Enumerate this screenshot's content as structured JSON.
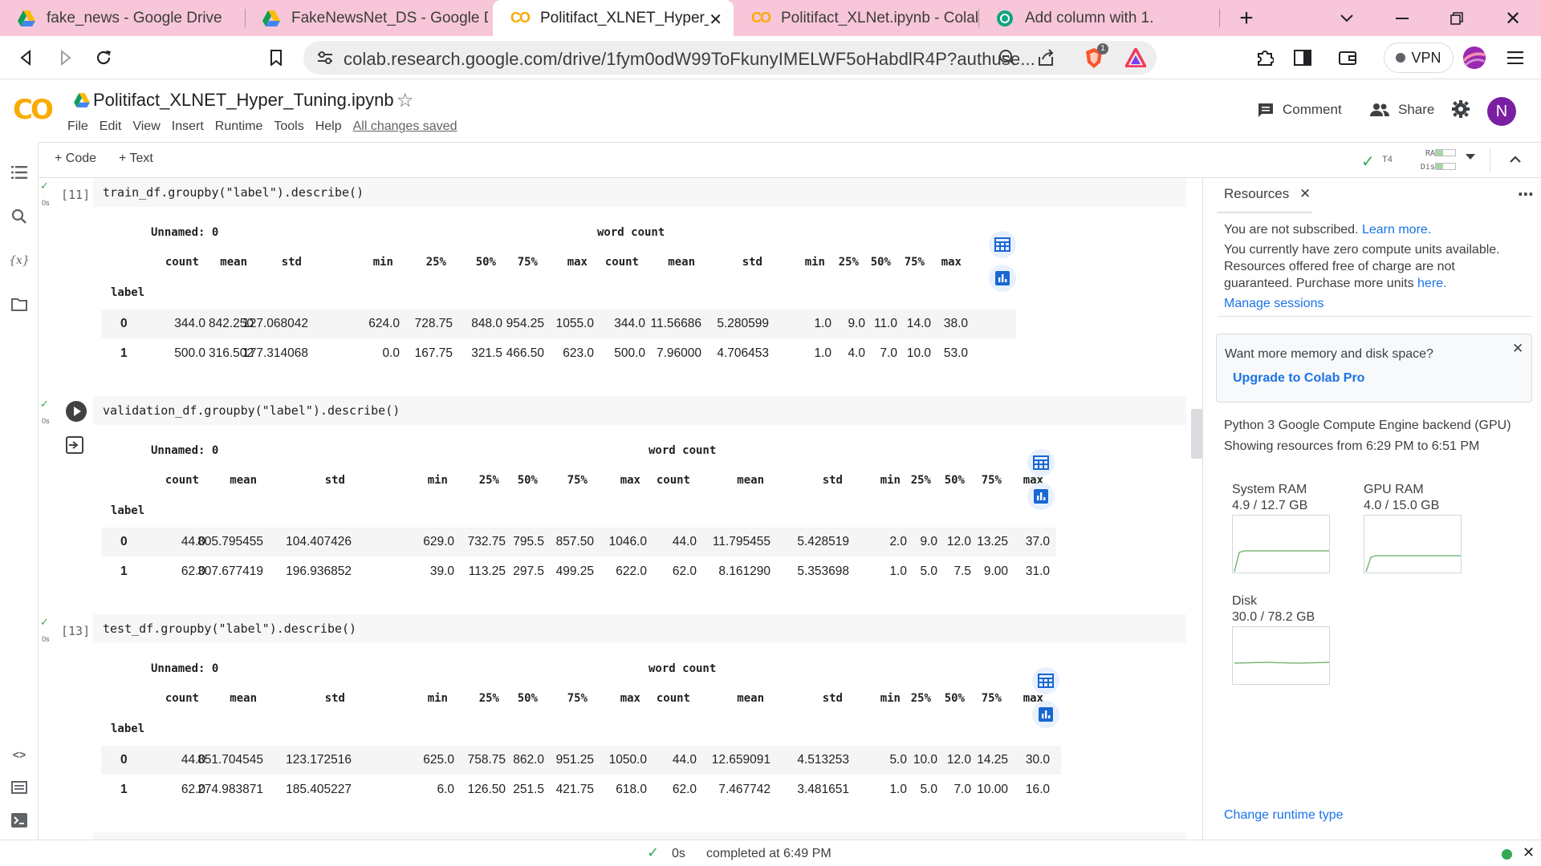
{
  "tabs": [
    {
      "title": "fake_news - Google Drive",
      "icon": "google-drive-icon"
    },
    {
      "title": "FakeNewsNet_DS - Google Drive",
      "icon": "google-drive-icon"
    },
    {
      "title": "Politifact_XLNET_Hyper_Tuning.ipynb",
      "icon": "colab-icon",
      "active": true
    },
    {
      "title": "Politifact_XLNet.ipynb - Colaboratory",
      "icon": "colab-icon"
    },
    {
      "title": "Add column with 1.",
      "icon": "chatgpt-icon"
    }
  ],
  "address": {
    "url": "colab.research.google.com/drive/1fym0odW99ToFkunyIMELWF5oHabdlR4P?authuse...",
    "shields_count": "1",
    "vpn_label": "VPN"
  },
  "colab": {
    "logo": "CO",
    "notebook_title": "Politifact_XLNET_Hyper_Tuning.ipynb",
    "menu": [
      "File",
      "Edit",
      "View",
      "Insert",
      "Runtime",
      "Tools",
      "Help"
    ],
    "saved_status": "All changes saved",
    "comment_label": "Comment",
    "share_label": "Share",
    "avatar_letter": "N"
  },
  "toolbar": {
    "code_label": "+ Code",
    "text_label": "+ Text",
    "runtime": "T4",
    "ram_label": "RAM",
    "disk_label": "Disk",
    "ram_fraction": 0.39,
    "disk_fraction": 0.38
  },
  "cells": [
    {
      "exec_label": "[11]",
      "time": "0s",
      "code": "train_df.groupby(\"label\").describe()",
      "group1": "Unnamed: 0",
      "group2": "word count",
      "columns": [
        "count",
        "mean",
        "std",
        "min",
        "25%",
        "50%",
        "75%",
        "max",
        "count",
        "mean",
        "std",
        "min",
        "25%",
        "50%",
        "75%",
        "max"
      ],
      "index_name": "label",
      "rows": [
        {
          "label": "0",
          "values": [
            "344.0",
            "842.250",
            "127.068042",
            "624.0",
            "728.75",
            "848.0",
            "954.25",
            "1055.0",
            "344.0",
            "11.56686",
            "5.280599",
            "1.0",
            "9.0",
            "11.0",
            "14.0",
            "38.0"
          ]
        },
        {
          "label": "1",
          "values": [
            "500.0",
            "316.502",
            "177.314068",
            "0.0",
            "167.75",
            "321.5",
            "466.50",
            "623.0",
            "500.0",
            "7.96000",
            "4.706453",
            "1.0",
            "4.0",
            "7.0",
            "10.0",
            "53.0"
          ]
        }
      ]
    },
    {
      "exec_label": "",
      "time": "0s",
      "code": "validation_df.groupby(\"label\").describe()",
      "group1": "Unnamed: 0",
      "group2": "word count",
      "columns": [
        "count",
        "mean",
        "std",
        "min",
        "25%",
        "50%",
        "75%",
        "max",
        "count",
        "mean",
        "std",
        "min",
        "25%",
        "50%",
        "75%",
        "max"
      ],
      "index_name": "label",
      "rows": [
        {
          "label": "0",
          "values": [
            "44.0",
            "805.795455",
            "104.407426",
            "629.0",
            "732.75",
            "795.5",
            "857.50",
            "1046.0",
            "44.0",
            "11.795455",
            "5.428519",
            "2.0",
            "9.0",
            "12.0",
            "13.25",
            "37.0"
          ]
        },
        {
          "label": "1",
          "values": [
            "62.0",
            "307.677419",
            "196.936852",
            "39.0",
            "113.25",
            "297.5",
            "499.25",
            "622.0",
            "62.0",
            "8.161290",
            "5.353698",
            "1.0",
            "5.0",
            "7.5",
            "9.00",
            "31.0"
          ]
        }
      ]
    },
    {
      "exec_label": "[13]",
      "time": "0s",
      "code": "test_df.groupby(\"label\").describe()",
      "group1": "Unnamed: 0",
      "group2": "word count",
      "columns": [
        "count",
        "mean",
        "std",
        "min",
        "25%",
        "50%",
        "75%",
        "max",
        "count",
        "mean",
        "std",
        "min",
        "25%",
        "50%",
        "75%",
        "max"
      ],
      "index_name": "label",
      "rows": [
        {
          "label": "0",
          "values": [
            "44.0",
            "851.704545",
            "123.172516",
            "625.0",
            "758.75",
            "862.0",
            "951.25",
            "1050.0",
            "44.0",
            "12.659091",
            "4.513253",
            "5.0",
            "10.0",
            "12.0",
            "14.25",
            "30.0"
          ]
        },
        {
          "label": "1",
          "values": [
            "62.0",
            "274.983871",
            "185.405227",
            "6.0",
            "126.50",
            "251.5",
            "421.75",
            "618.0",
            "62.0",
            "7.467742",
            "3.481651",
            "1.0",
            "5.0",
            "7.0",
            "10.00",
            "16.0"
          ]
        }
      ]
    }
  ],
  "resources": {
    "title": "Resources",
    "not_subscribed": "You are not subscribed.",
    "learn_more": "Learn more.",
    "compute_units_1": "You currently have zero compute units available.",
    "compute_units_2": "Resources offered free of charge are not",
    "compute_units_3": "guaranteed. Purchase more units",
    "here": "here.",
    "manage_sessions": "Manage sessions",
    "want_more": "Want more memory and disk space?",
    "upgrade": "Upgrade to Colab Pro",
    "backend": "Python 3 Google Compute Engine backend (GPU)",
    "showing": "Showing resources from 6:29 PM to 6:51 PM",
    "system_ram_label": "System RAM",
    "system_ram_value": "4.9 / 12.7 GB",
    "gpu_ram_label": "GPU RAM",
    "gpu_ram_value": "4.0 / 15.0 GB",
    "disk_label": "Disk",
    "disk_value": "30.0 / 78.2 GB",
    "change_runtime": "Change runtime type"
  },
  "status": {
    "elapsed": "0s",
    "completed": "completed at 6:49 PM"
  },
  "colors": {
    "tab_strip": "#f7c6d9",
    "colab_orange": "#f9ab00",
    "link_blue": "#1a73e8",
    "success_green": "#34a853",
    "avatar_purple": "#7b1fa2"
  }
}
